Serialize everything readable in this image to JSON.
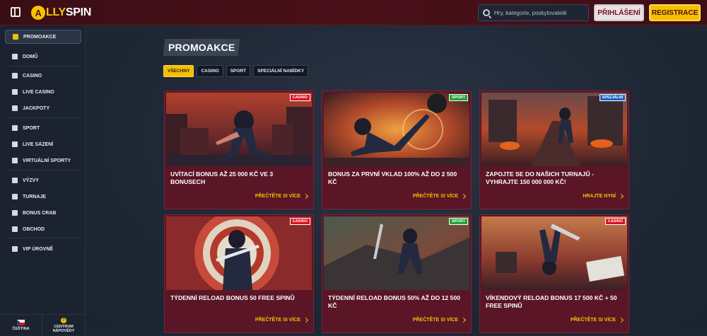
{
  "header": {
    "logo_letter": "A",
    "logo_part1": "LLY",
    "logo_part2": "SPIN",
    "search_placeholder": "Hry, kategorie, poskytovatelé",
    "login_label": "PŘIHLÁŠENÍ",
    "register_label": "REGISTRACE"
  },
  "sidebar": {
    "items": [
      {
        "label": "PROMOAKCE",
        "icon": "gift-icon"
      },
      {
        "label": "DOMŮ",
        "icon": "home-icon"
      },
      {
        "label": "CASINO",
        "icon": "slot-icon"
      },
      {
        "label": "LIVE CASINO",
        "icon": "cards-icon"
      },
      {
        "label": "JACKPOTY",
        "icon": "clover-icon"
      },
      {
        "label": "SPORT",
        "icon": "ball-icon"
      },
      {
        "label": "LIVE SÁZENÍ",
        "icon": "live-icon"
      },
      {
        "label": "VIRTUÁLNÍ SPORTY",
        "icon": "virtual-icon"
      },
      {
        "label": "VÝZVY",
        "icon": "medal-icon"
      },
      {
        "label": "TURNAJE",
        "icon": "trophy-icon"
      },
      {
        "label": "BONUS CRAB",
        "icon": "crab-icon"
      },
      {
        "label": "OBCHOD",
        "icon": "cart-icon"
      },
      {
        "label": "VIP ÚROVNĚ",
        "icon": "diamond-icon"
      }
    ],
    "language_label": "ČEŠTINA",
    "help_label_1": "CENTRUM",
    "help_label_2": "NÁPOVĚDY"
  },
  "main": {
    "title": "PROMOAKCE",
    "filters": [
      "VŠECHNY",
      "CASINO",
      "SPORT",
      "SPECIÁLNÍ NABÍDKY"
    ],
    "cards": [
      {
        "badge": "CASINO",
        "text": "UVÍTACÍ BONUS AŽ 25 000 KČ VE 3 BONUSECH",
        "link": "PŘEČTĚTE SI VÍCE"
      },
      {
        "badge": "SPORT",
        "text": "BONUS ZA PRVNÍ VKLAD 100% AŽ DO 2 500 KČ",
        "link": "PŘEČTĚTE SI VÍCE"
      },
      {
        "badge": "SPECIÁLNÍ",
        "text": "ZAPOJTE SE DO NAŠICH TURNAJŮ - VYHRAJTE 150 000 000 KČ!",
        "link": "HRAJTE NYNÍ"
      },
      {
        "badge": "CASINO",
        "text": "TÝDENNÍ RELOAD BONUS 50 FREE SPINŮ",
        "link": "PŘEČTĚTE SI VÍCE"
      },
      {
        "badge": "SPORT",
        "text": "TÝDENNÍ RELOAD BONUS 50% AŽ DO 12 500 KČ",
        "link": "PŘEČTĚTE SI VÍCE"
      },
      {
        "badge": "CASINO",
        "text": "VÍKENDOVÝ RELOAD BONUS 17 500 KČ + 50 FREE SPINŮ",
        "link": "PŘEČTĚTE SI VÍCE"
      }
    ]
  },
  "colors": {
    "accent": "#f5c000",
    "card_bg": "#5a1626",
    "header_bg": "#3a0d14",
    "badge_casino": "#d8121f",
    "badge_sport": "#23a23a",
    "badge_special": "#1b65c6"
  }
}
